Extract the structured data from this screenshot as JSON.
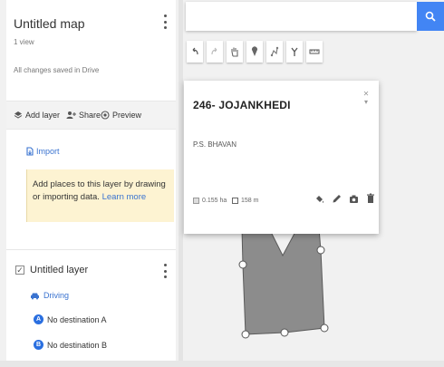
{
  "map": {
    "title": "Untitled map",
    "views": "1 view",
    "save_status": "All changes saved in Drive"
  },
  "actions": {
    "add_layer": "Add layer",
    "share": "Share",
    "preview": "Preview"
  },
  "base_layer": {
    "import_label": "Import",
    "hint_text": "Add places to this layer by drawing or importing data.",
    "hint_link": "Learn more"
  },
  "directions_layer": {
    "name": "Untitled layer",
    "mode": "Driving",
    "destinations": [
      {
        "marker": "A",
        "label": "No destination A"
      },
      {
        "marker": "B",
        "label": "No destination B"
      }
    ]
  },
  "search": {
    "placeholder": ""
  },
  "toolbar_icons": [
    "undo-icon",
    "redo-icon",
    "hand-icon",
    "marker-icon",
    "line-icon",
    "route-icon",
    "ruler-icon"
  ],
  "feature_card": {
    "title": "246- JOJANKHEDI",
    "description": "P.S. BHAVAN",
    "area": "0.155 ha",
    "perimeter": "158 m"
  },
  "colors": {
    "accent_blue": "#4285f4",
    "link_blue": "#3a73d0",
    "hint_bg": "#fdf3d2",
    "polygon_fill": "#8c8c8c"
  }
}
